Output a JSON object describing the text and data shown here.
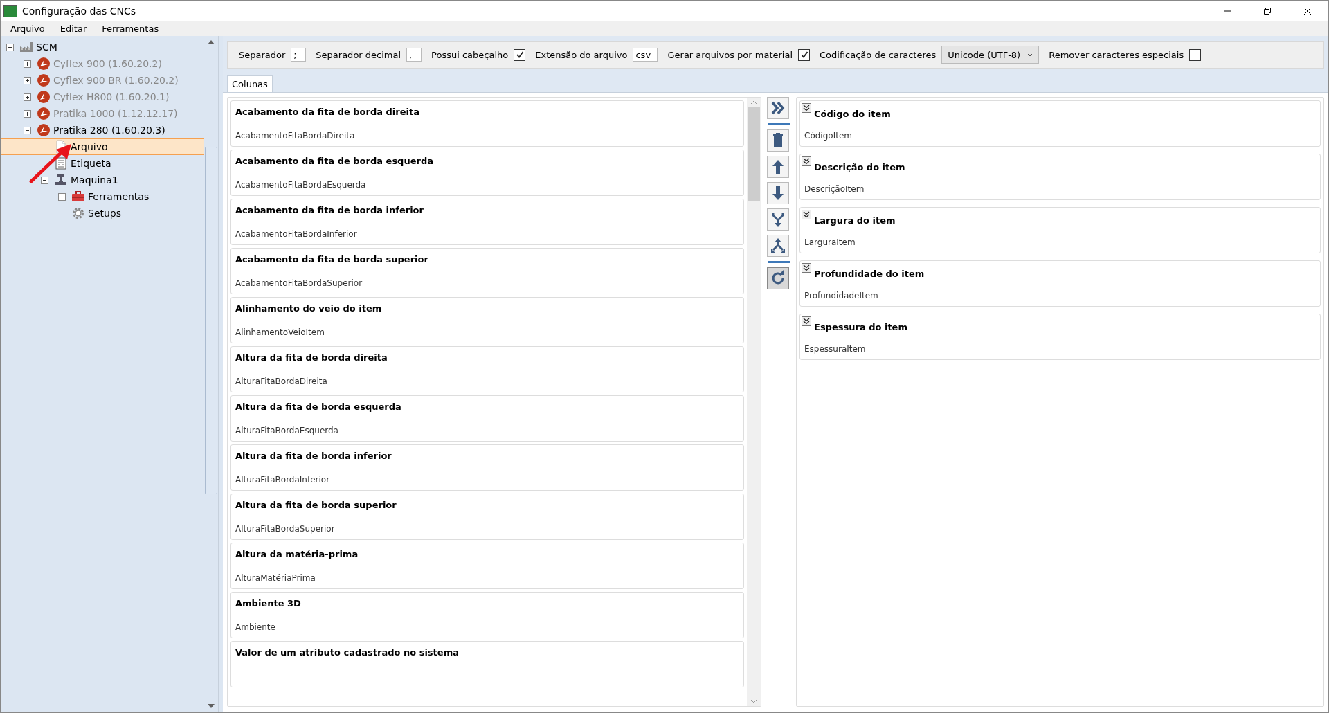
{
  "window": {
    "title": "Configuração das CNCs"
  },
  "menu": [
    "Arquivo",
    "Editar",
    "Ferramentas"
  ],
  "tree": [
    {
      "label": "SCM",
      "kind": "factory",
      "expanded": true,
      "selected": false,
      "disabled": false,
      "children": [
        {
          "label": "Cyflex 900 (1.60.20.2)",
          "kind": "brand",
          "expanded": false,
          "selected": false,
          "disabled": true
        },
        {
          "label": "Cyflex 900 BR (1.60.20.2)",
          "kind": "brand",
          "expanded": false,
          "selected": false,
          "disabled": true
        },
        {
          "label": "Cyflex H800 (1.60.20.1)",
          "kind": "brand",
          "expanded": false,
          "selected": false,
          "disabled": true
        },
        {
          "label": "Pratika 1000 (1.12.12.17)",
          "kind": "brand",
          "expanded": false,
          "selected": false,
          "disabled": true
        },
        {
          "label": "Pratika 280 (1.60.20.3)",
          "kind": "brand",
          "expanded": true,
          "selected": false,
          "disabled": false,
          "children": [
            {
              "label": "Arquivo",
              "kind": "document",
              "selected": true,
              "disabled": false
            },
            {
              "label": "Etiqueta",
              "kind": "label",
              "selected": false,
              "disabled": false
            },
            {
              "label": "Maquina1",
              "kind": "machine",
              "expanded": true,
              "selected": false,
              "disabled": false,
              "children": [
                {
                  "label": "Ferramentas",
                  "kind": "toolbox",
                  "expanded": false,
                  "selected": false,
                  "disabled": false
                },
                {
                  "label": "Setups",
                  "kind": "gear",
                  "selected": false,
                  "disabled": false
                }
              ]
            }
          ]
        }
      ]
    }
  ],
  "settings": {
    "separator_label": "Separador",
    "separator": ";",
    "decimal_label": "Separador decimal",
    "decimal": ",",
    "header_label": "Possui cabeçalho",
    "header_checked": true,
    "extension_label": "Extensão do arquivo",
    "extension": "csv",
    "per_material_label": "Gerar arquivos por material",
    "per_material_checked": true,
    "encoding_label": "Codificação de caracteres",
    "encoding": "Unicode (UTF-8)",
    "remove_label": "Remover caracteres especiais",
    "remove_checked": false
  },
  "tabs": [
    {
      "label": "Colunas",
      "selected": true
    }
  ],
  "available_columns": [
    {
      "title": "Acabamento da fita de borda direita",
      "field": "AcabamentoFitaBordaDireita"
    },
    {
      "title": "Acabamento da fita de borda esquerda",
      "field": "AcabamentoFitaBordaEsquerda"
    },
    {
      "title": "Acabamento da fita de borda inferior",
      "field": "AcabamentoFitaBordaInferior"
    },
    {
      "title": "Acabamento da fita de borda superior",
      "field": "AcabamentoFitaBordaSuperior"
    },
    {
      "title": "Alinhamento do veio do item",
      "field": "AlinhamentoVeioItem"
    },
    {
      "title": "Altura da fita de borda direita",
      "field": "AlturaFitaBordaDireita"
    },
    {
      "title": "Altura da fita de borda esquerda",
      "field": "AlturaFitaBordaEsquerda"
    },
    {
      "title": "Altura da fita de borda inferior",
      "field": "AlturaFitaBordaInferior"
    },
    {
      "title": "Altura da fita de borda superior",
      "field": "AlturaFitaBordaSuperior"
    },
    {
      "title": "Altura da matéria-prima",
      "field": "AlturaMatériaPrima"
    },
    {
      "title": "Ambiente 3D",
      "field": "Ambiente"
    },
    {
      "title": "Valor de um atributo cadastrado no sistema"
    }
  ],
  "action_buttons": [
    {
      "pressed": false
    },
    {
      "pressed": false
    },
    {
      "pressed": false
    },
    {
      "pressed": false
    },
    {
      "pressed": false
    },
    {
      "pressed": false
    },
    {
      "pressed": true
    }
  ],
  "selected_columns": [
    {
      "title": "Código do item",
      "field": "CódigoItem"
    },
    {
      "title": "Descrição do item",
      "field": "DescriçãoItem"
    },
    {
      "title": "Largura do item",
      "field": "LarguraItem"
    },
    {
      "title": "Profundidade do item",
      "field": "ProfundidadeItem"
    },
    {
      "title": "Espessura do item",
      "field": "EspessuraItem"
    }
  ]
}
